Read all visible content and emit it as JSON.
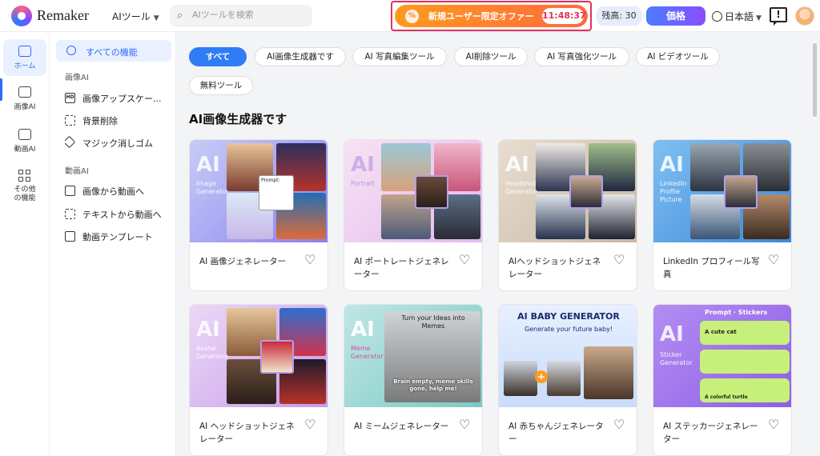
{
  "header": {
    "brand": "Remaker",
    "tools_menu": "AIツール",
    "search_placeholder": "AIツールを検索",
    "promo_label": "新規ユーザー限定オファー",
    "promo_timer": "11:48:37",
    "credits": "残高: 30",
    "price_button": "価格",
    "language": "日本語"
  },
  "rail": [
    {
      "label": "ホーム",
      "icon": "home-icon",
      "active": true
    },
    {
      "label": "画像AI",
      "icon": "image-icon",
      "active": false
    },
    {
      "label": "動画AI",
      "icon": "video-icon",
      "active": false
    },
    {
      "label": "その他の機能",
      "icon": "apps-icon",
      "active": false
    }
  ],
  "sidebar": {
    "all_features": "すべての機能",
    "image_section": "画像AI",
    "image_items": [
      "画像アップスケー...",
      "背景削除",
      "マジック消しゴム"
    ],
    "video_section": "動画AI",
    "video_items": [
      "画像から動画へ",
      "テキストから動画へ",
      "動画テンプレート"
    ]
  },
  "filters": [
    "すべて",
    "AI画像生成器です",
    "AI 写真編集ツール",
    "AI削除ツール",
    "AI 写真強化ツール",
    "AI ビデオツール",
    "無料ツール"
  ],
  "section_title": "AI画像生成器です",
  "cards": [
    {
      "title": "AI 画像ジェネレーター",
      "thumb_big": "AI",
      "thumb_small": "Image Generator",
      "colors": [
        "#c6cdf7",
        "#8a7ff0"
      ]
    },
    {
      "title": "AI ポートレートジェネレーター",
      "thumb_big": "AI",
      "thumb_small": "Portrait",
      "colors": [
        "#f7e3f3",
        "#e3b8f0"
      ]
    },
    {
      "title": "AIヘッドショットジェネレーター",
      "thumb_big": "AI",
      "thumb_small": "Headshot Generator",
      "colors": [
        "#e8ddd0",
        "#c9b7a2"
      ]
    },
    {
      "title": "LinkedIn プロフィール写真",
      "thumb_big": "AI",
      "thumb_small": "LinkedIn Profile Picture",
      "colors": [
        "#7fc0f2",
        "#3d86d9"
      ]
    },
    {
      "title": "AI ヘッドショットジェネレーター",
      "thumb_big": "AI",
      "thumb_small": "Avatar Generator",
      "colors": [
        "#ecd8f7",
        "#c59be8"
      ]
    },
    {
      "title": "AI ミームジェネレーター",
      "thumb_big": "AI",
      "thumb_small": "Meme Generator",
      "colors": [
        "#bfe7e4",
        "#7bc9c4"
      ]
    },
    {
      "title": "AI 赤ちゃんジェネレーター",
      "thumb_big": "AI BABY GENERATOR",
      "thumb_small": "Generate your future baby!",
      "colors": [
        "#e7f0ff",
        "#c9dcfb"
      ]
    },
    {
      "title": "AI ステッカージェネレーター",
      "thumb_big": "AI",
      "thumb_small": "Sticker Generator",
      "colors": [
        "#b38df2",
        "#8f5ee6"
      ]
    }
  ],
  "meme_caption_top": "Turn your Ideas into Memes",
  "meme_caption_bottom": "Brain empty, meme skills gone, help me!",
  "sticker_header": "Prompt · Stickers",
  "sticker_rows": [
    "A cute cat",
    "",
    "A colorful turtle"
  ],
  "portrait_prompt": "Prompt:"
}
